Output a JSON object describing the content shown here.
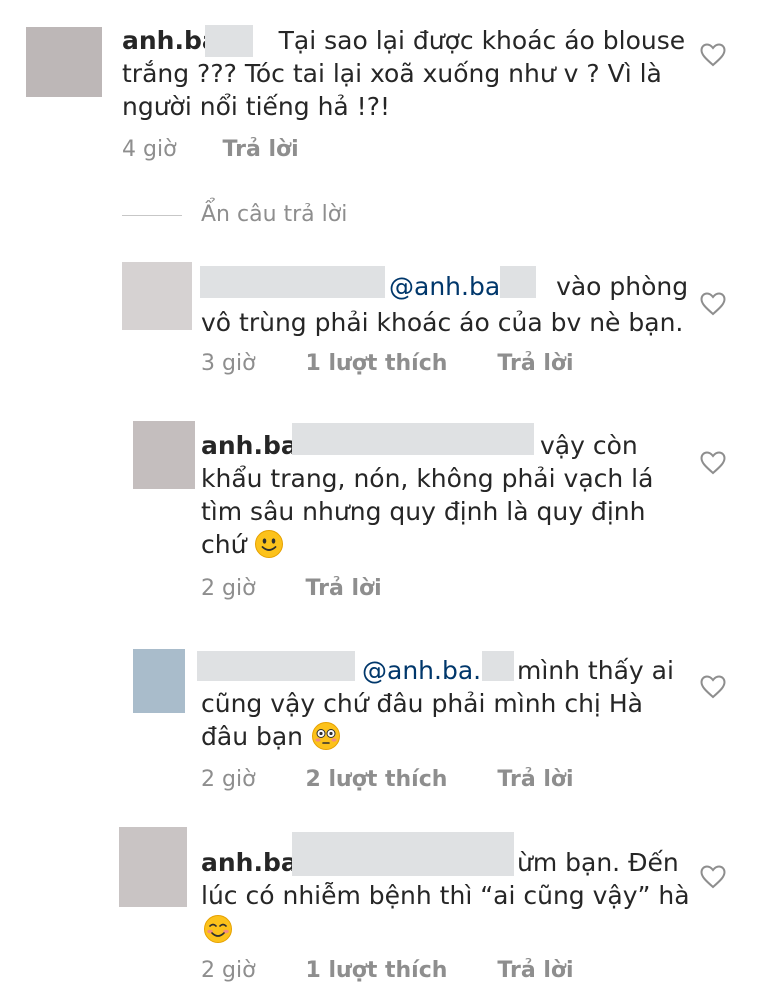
{
  "comments": [
    {
      "username": "anh.ba",
      "lines": [
        "Tại sao lại được khoác áo blouse",
        "trắng ??? Tóc tai lại xoã xuống như v ? Vì là",
        "người nổi tiếng hả !?!"
      ],
      "time": "4 giờ",
      "reply": "Trả lời",
      "avatar_color": "#bdb7b7"
    },
    {
      "hide_replies": "Ẩn câu trả lời"
    },
    {
      "mention": "@anh.ba",
      "lines": [
        "vào phòng",
        "vô trùng phải khoác áo của bv nè bạn."
      ],
      "time": "3 giờ",
      "likes": "1 lượt thích",
      "reply": "Trả lời",
      "avatar_color": "#d6d2d2"
    },
    {
      "username": "anh.ba.",
      "lines": [
        "vậy còn",
        "khẩu trang, nón, không phải vạch lá",
        "tìm sâu nhưng quy định là quy định",
        "chứ"
      ],
      "time": "2 giờ",
      "reply": "Trả lời",
      "avatar_color": "#c4bebe"
    },
    {
      "mention": "@anh.ba.",
      "lines": [
        "mình thấy ai",
        "cũng vậy chứ đâu phải mình chị Hà",
        "đâu bạn"
      ],
      "time": "2 giờ",
      "likes": "2 lượt thích",
      "reply": "Trả lời",
      "avatar_color": "#a9bccb"
    },
    {
      "username": "anh.ba.",
      "lines": [
        "ừm bạn. Đến",
        "lúc có nhiễm bệnh thì “ai cũng vậy” hà"
      ],
      "time": "2 giờ",
      "likes": "1 lượt thích",
      "reply": "Trả lời",
      "avatar_color": "#c9c4c4"
    }
  ],
  "icons": {
    "like": "heart-outline-icon",
    "emoji_smile": "smiling-face-icon",
    "emoji_flushed": "flushed-face-icon",
    "emoji_blush": "blushing-face-icon"
  },
  "colors": {
    "text": "#262626",
    "mention": "#00376b",
    "meta": "#8e8e8e"
  }
}
